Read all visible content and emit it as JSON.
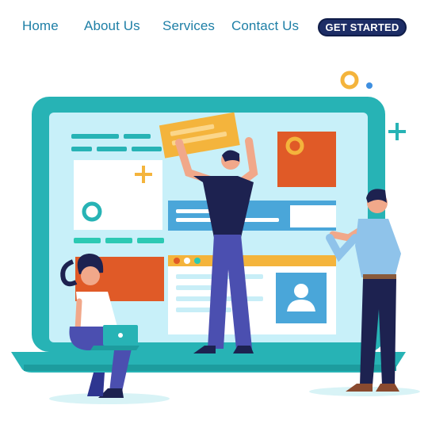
{
  "nav": {
    "links": [
      {
        "label": "Home"
      },
      {
        "label": "About Us"
      },
      {
        "label": "Services"
      },
      {
        "label": "Contact Us"
      }
    ],
    "cta_label": "GET STARTED"
  },
  "colors": {
    "link": "#1e7fa6",
    "cta_background": "#1d2d66",
    "laptop_frame": "#27b3b5",
    "screen": "#c8f0f9",
    "accent_orange": "#e05a27",
    "accent_yellow": "#f4b43c",
    "window_blue": "#4aa6d9"
  },
  "illustration": {
    "subject": "team building a web page on a laptop screen",
    "icons": [
      "plus-icon",
      "ring-icon",
      "user-placeholder-icon"
    ]
  }
}
